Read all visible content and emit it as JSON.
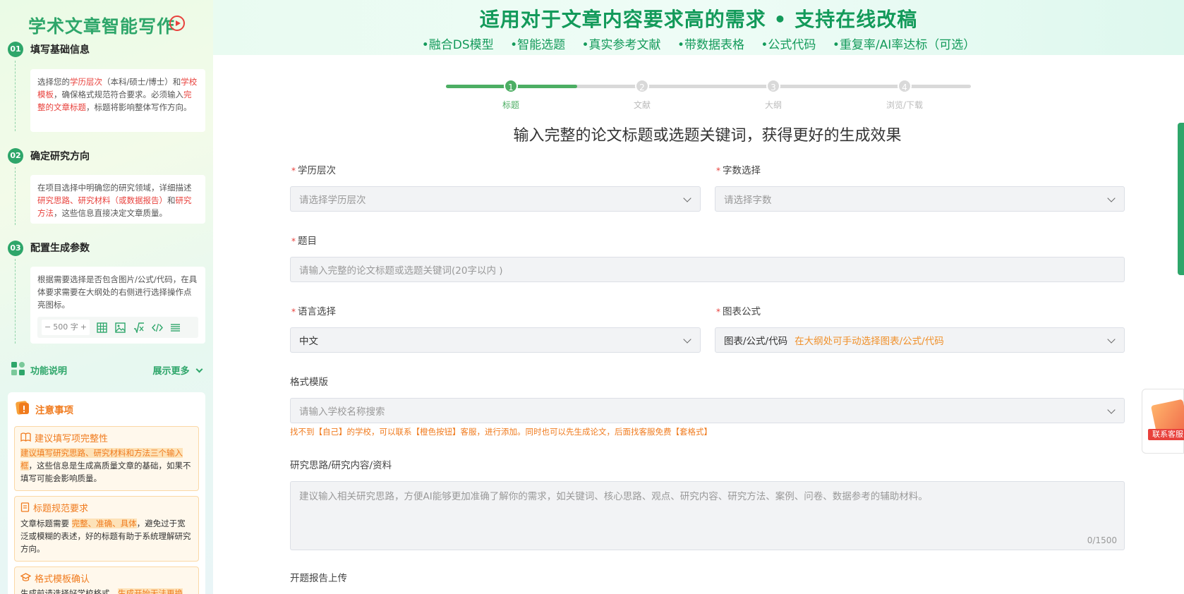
{
  "sidebar": {
    "title": "学术文章智能写作",
    "steps": [
      {
        "num": "01",
        "title": "填写基础信息",
        "parts": [
          "选择您的",
          "学历层次",
          "（本科/硕士/博士）和",
          "学校模板",
          "，确保格式规范符合要求。必须输入",
          "完整的文章标题",
          "，标题将影响整体写作方向。"
        ]
      },
      {
        "num": "02",
        "title": "确定研究方向",
        "parts": [
          "在项目选择中明确您的研究领域，详细描述",
          "研究思路、研究材料（或数据报告）",
          "和",
          "研究方法",
          "，这些信息直接决定文章质量。"
        ]
      },
      {
        "num": "03",
        "title": "配置生成参数",
        "text": "根据需要选择是否包含图片/公式/代码，在具体要求需要在大纲处的右侧进行选择操作点亮图标。",
        "word_count": "500 字"
      }
    ],
    "func_label": "功能说明",
    "show_more": "展示更多",
    "notice": {
      "title": "注意事项",
      "items": [
        {
          "title": "建议填写项完整性",
          "highlight": "建议填写研究思路、研究材料和方法三个输入框",
          "rest": "，这些信息是生成高质量文章的基础，如果不填写可能会影响质量。"
        },
        {
          "title": "标题规范要求",
          "before": "文章标题需要 ",
          "highlight": "完整、准确、具体",
          "rest": "，避免过于宽泛或模糊的表述，好的标题有助于系统理解研究方向。"
        },
        {
          "title": "格式模板确认",
          "before": "生成前请选择好学校格式，",
          "highlight": "生成开始无法更换"
        }
      ]
    }
  },
  "banner": {
    "title": "适用对于文章内容要求高的需求 • 支持在线改稿",
    "features": [
      "•融合DS模型",
      "•智能选题",
      "•真实参考文献",
      "•带数据表格",
      "•公式代码",
      "•重复率/AI率达标（可选）"
    ]
  },
  "stepper": {
    "progress": 0.25,
    "steps": [
      {
        "num": "1",
        "label": "标题"
      },
      {
        "num": "2",
        "label": "文献"
      },
      {
        "num": "3",
        "label": "大纲"
      },
      {
        "num": "4",
        "label": "浏览/下载"
      }
    ]
  },
  "form": {
    "heading": "输入完整的论文标题或选题关键词，获得更好的生成效果",
    "required_mark": "*",
    "degree": {
      "label": "学历层次",
      "placeholder": "请选择学历层次"
    },
    "wordcount": {
      "label": "字数选择",
      "placeholder": "请选择字数"
    },
    "topic": {
      "label": "题目",
      "placeholder": "请输入完整的论文标题或选题关键词(20字以内 )"
    },
    "language": {
      "label": "语言选择",
      "value": "中文"
    },
    "chart_formula": {
      "label": "图表公式",
      "value": "图表/公式/代码",
      "hint": "在大纲处可手动选择图表/公式/代码"
    },
    "template": {
      "label": "格式模版",
      "placeholder": "请输入学校名称搜索",
      "note": "找不到【自己】的学校，可以联系【橙色按钮】客服，进行添加。同时也可以先生成论文，后面找客服免费【套格式】"
    },
    "research": {
      "label": "研究思路/研究内容/资料",
      "placeholder": "建议输入相关研究思路，方便AI能够更加准确了解你的需求，如关键词、核心思路、观点、研究内容、研究方法、案例、问卷、数据参考的辅助材料。",
      "counter": "0/1500"
    },
    "proposal": {
      "label": "开题报告上传"
    }
  },
  "customer_service": {
    "label": "联系客服"
  },
  "colors": {
    "brand_green": "#2ea66a",
    "accent_orange": "#f07b1e",
    "required_red": "#e8413c"
  }
}
